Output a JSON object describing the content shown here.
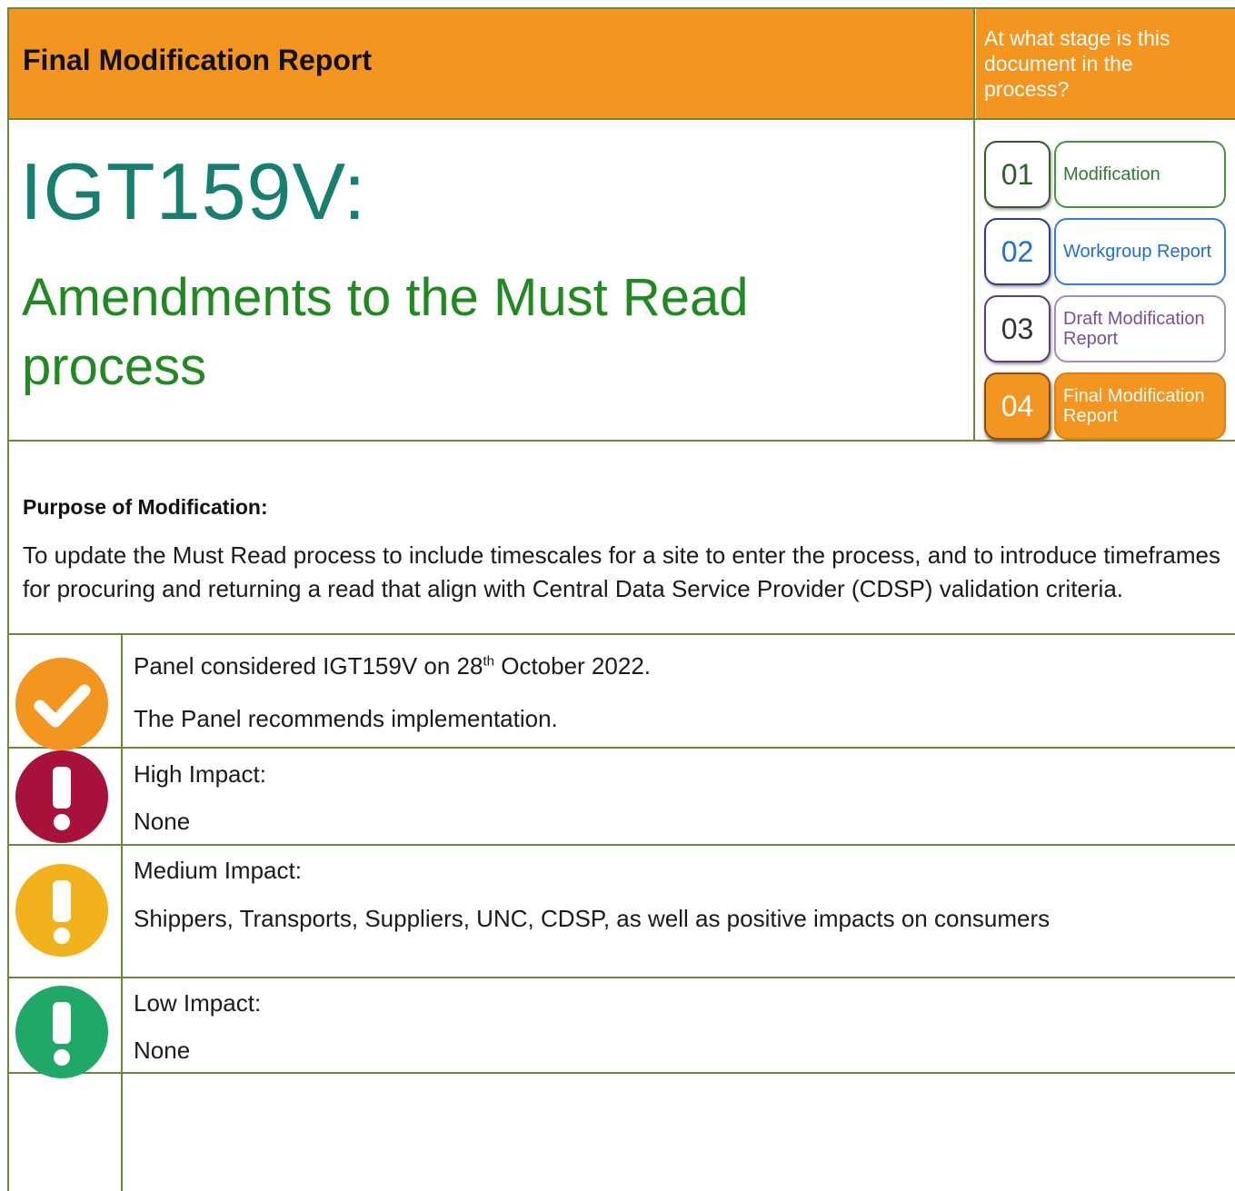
{
  "header": {
    "title": "Final Modification Report",
    "stage_question": "At what stage is this document in the process?"
  },
  "modification": {
    "code": "IGT159V:",
    "name": "Amendments to the Must Read process"
  },
  "stages": [
    {
      "number": "01",
      "label": "Modification",
      "color": "#2e7d32",
      "active": false
    },
    {
      "number": "02",
      "label": "Workgroup Report",
      "color": "#1e6fd6",
      "active": false
    },
    {
      "number": "03",
      "label": "Draft Modification Report",
      "color": "#7a4fa0",
      "active": false
    },
    {
      "number": "04",
      "label": "Final Modification Report",
      "color": "#f3951e",
      "active": true
    }
  ],
  "purpose": {
    "title": "Purpose of Modification:",
    "text": "To update the Must Read process to include timescales for a site to enter the process, and to introduce timeframes for procuring and returning a read that align with Central Data Service Provider (CDSP) validation criteria."
  },
  "panel": {
    "line1_pre": "Panel considered IGT159V on 28",
    "line1_sup": "th",
    "line1_post": " October 2022.",
    "line2": "The Panel recommends implementation.",
    "icon_color": "#f3951e"
  },
  "impacts": [
    {
      "title": "High Impact:",
      "text": "None",
      "color": "#a8123a"
    },
    {
      "title": "Medium Impact:",
      "text": "Shippers, Transports, Suppliers, UNC, CDSP, as well as positive impacts on consumers",
      "color": "#f1b21b"
    },
    {
      "title": "Low Impact:",
      "text": "None",
      "color": "#1fa866"
    }
  ]
}
